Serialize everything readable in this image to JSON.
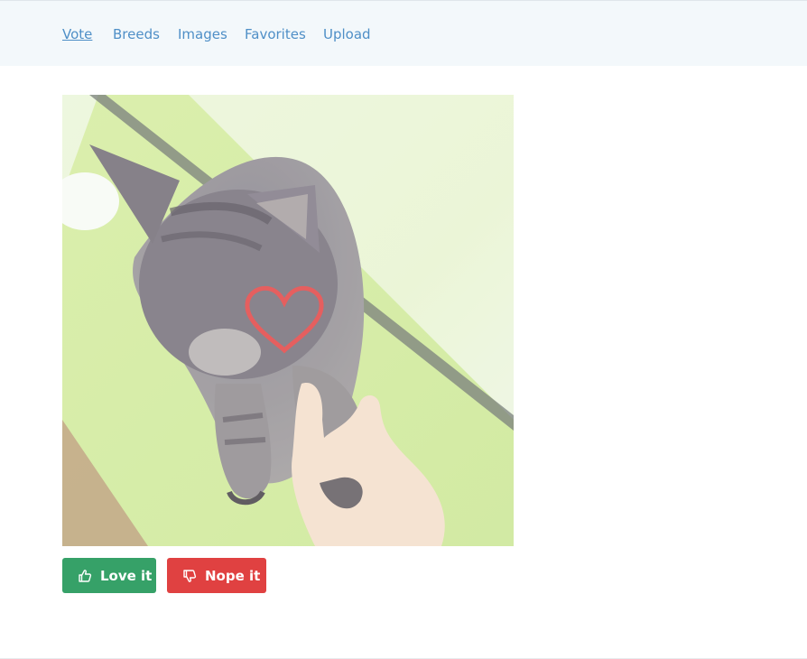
{
  "nav": {
    "items": [
      {
        "label": "Vote",
        "active": true
      },
      {
        "label": "Breeds",
        "active": false
      },
      {
        "label": "Images",
        "active": false
      },
      {
        "label": "Favorites",
        "active": false
      },
      {
        "label": "Upload",
        "active": false
      }
    ]
  },
  "vote": {
    "image_icon": "heart-outline-icon",
    "love_label": "Love it",
    "love_icon": "thumbs-up-icon",
    "nope_label": "Nope it",
    "nope_icon": "thumbs-down-icon"
  },
  "colors": {
    "nav_background": "#f3f8fb",
    "link": "#4f8fc7",
    "love": "#36a168",
    "nope": "#e04141",
    "heart": "#e03c3c"
  }
}
